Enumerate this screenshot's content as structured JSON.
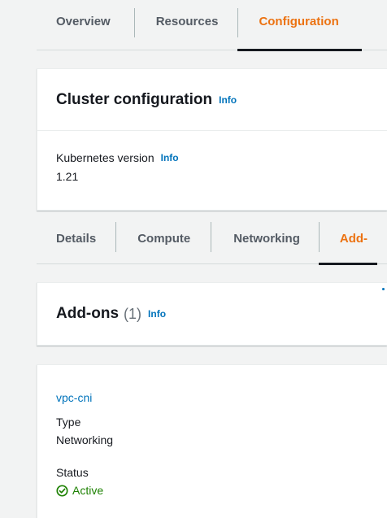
{
  "top_tabs": [
    {
      "label": "Overview",
      "active": false
    },
    {
      "label": "Resources",
      "active": false
    },
    {
      "label": "Configuration",
      "active": true
    }
  ],
  "cluster_config": {
    "title": "Cluster configuration",
    "info": "Info",
    "kubernetes_version_label": "Kubernetes version",
    "kubernetes_version_info": "Info",
    "kubernetes_version_value": "1.21"
  },
  "sub_tabs": [
    {
      "label": "Details",
      "active": false
    },
    {
      "label": "Compute",
      "active": false
    },
    {
      "label": "Networking",
      "active": false
    },
    {
      "label": "Add-",
      "active": true
    }
  ],
  "addons": {
    "title": "Add-ons",
    "count": "(1)",
    "info": "Info",
    "item": {
      "name": "vpc-cni",
      "type_label": "Type",
      "type_value": "Networking",
      "status_label": "Status",
      "status_value": "Active"
    }
  },
  "colors": {
    "accent": "#ec7211",
    "link": "#0073bb",
    "success": "#1d8102",
    "background": "#f2f3f3"
  },
  "icons": {
    "status": "check-circle-icon"
  }
}
